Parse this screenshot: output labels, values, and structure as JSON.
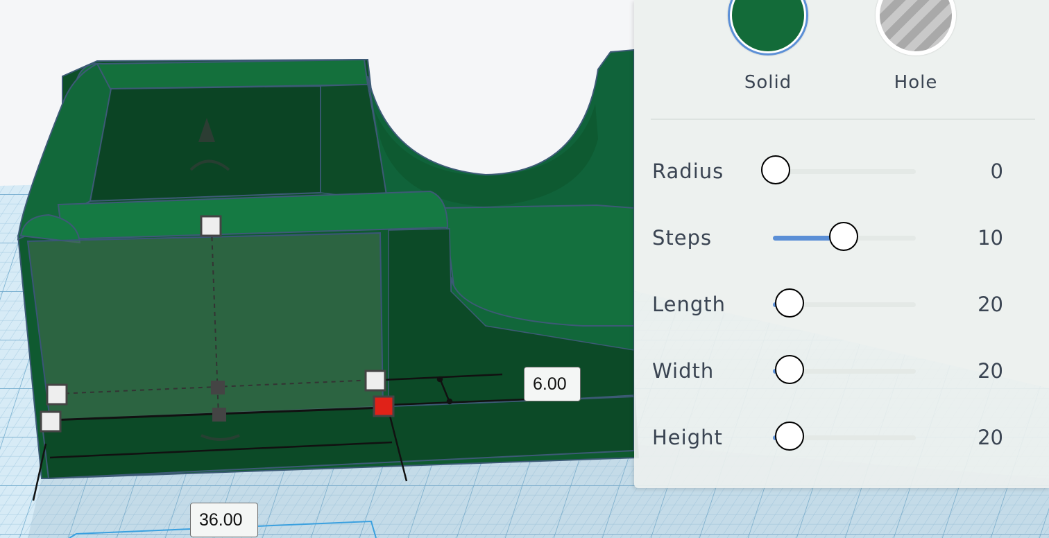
{
  "shape_type": {
    "solid_label": "Solid",
    "hole_label": "Hole",
    "selected": "solid",
    "solid_color": "#136b39"
  },
  "params": [
    {
      "label": "Radius",
      "value": "0",
      "min": 0,
      "max": 20,
      "num": 0
    },
    {
      "label": "Steps",
      "value": "10",
      "min": 1,
      "max": 20,
      "num": 10
    },
    {
      "label": "Length",
      "value": "20",
      "min": 1,
      "max": 200,
      "num": 20
    },
    {
      "label": "Width",
      "value": "20",
      "min": 1,
      "max": 200,
      "num": 20
    },
    {
      "label": "Height",
      "value": "20",
      "min": 1,
      "max": 200,
      "num": 20
    }
  ],
  "dimensions": {
    "height_value": "6.00",
    "width_value": "36.00"
  },
  "colors": {
    "model_green": "#0f5a30",
    "accent_blue": "#5b8fd6",
    "grid_blue": "#cfe6f3",
    "handle_red": "#e02218"
  }
}
